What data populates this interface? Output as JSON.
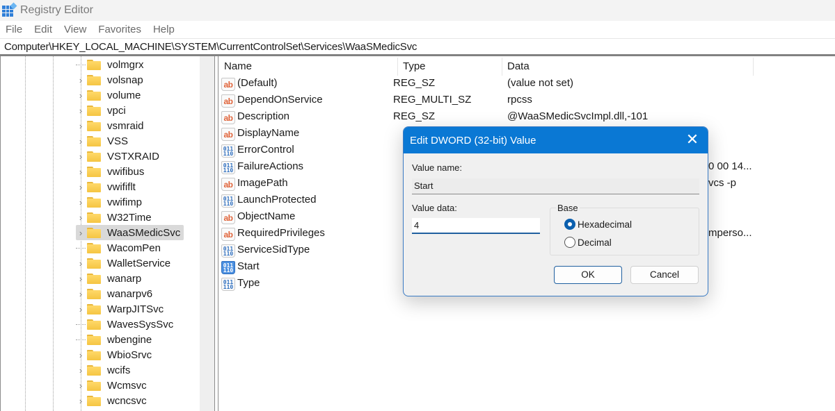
{
  "window": {
    "title": "Registry Editor"
  },
  "menu": [
    "File",
    "Edit",
    "View",
    "Favorites",
    "Help"
  ],
  "address": "Computer\\HKEY_LOCAL_MACHINE\\SYSTEM\\CurrentControlSet\\Services\\WaaSMedicSvc",
  "tree": {
    "items": [
      {
        "label": "volmgrx",
        "expandable": false,
        "selected": false
      },
      {
        "label": "volsnap",
        "expandable": true,
        "selected": false
      },
      {
        "label": "volume",
        "expandable": true,
        "selected": false
      },
      {
        "label": "vpci",
        "expandable": true,
        "selected": false
      },
      {
        "label": "vsmraid",
        "expandable": true,
        "selected": false
      },
      {
        "label": "VSS",
        "expandable": true,
        "selected": false
      },
      {
        "label": "VSTXRAID",
        "expandable": true,
        "selected": false
      },
      {
        "label": "vwifibus",
        "expandable": true,
        "selected": false
      },
      {
        "label": "vwififlt",
        "expandable": true,
        "selected": false
      },
      {
        "label": "vwifimp",
        "expandable": true,
        "selected": false
      },
      {
        "label": "W32Time",
        "expandable": true,
        "selected": false
      },
      {
        "label": "WaaSMedicSvc",
        "expandable": true,
        "selected": true
      },
      {
        "label": "WacomPen",
        "expandable": false,
        "selected": false
      },
      {
        "label": "WalletService",
        "expandable": true,
        "selected": false
      },
      {
        "label": "wanarp",
        "expandable": true,
        "selected": false
      },
      {
        "label": "wanarpv6",
        "expandable": true,
        "selected": false
      },
      {
        "label": "WarpJITSvc",
        "expandable": true,
        "selected": false
      },
      {
        "label": "WavesSysSvc",
        "expandable": false,
        "selected": false
      },
      {
        "label": "wbengine",
        "expandable": false,
        "selected": false
      },
      {
        "label": "WbioSrvc",
        "expandable": true,
        "selected": false
      },
      {
        "label": "wcifs",
        "expandable": true,
        "selected": false
      },
      {
        "label": "Wcmsvc",
        "expandable": true,
        "selected": false
      },
      {
        "label": "wcncsvc",
        "expandable": true,
        "selected": false
      }
    ]
  },
  "values_list": {
    "columns": {
      "name": "Name",
      "type": "Type",
      "data": "Data"
    },
    "rows": [
      {
        "name": "(Default)",
        "type": "REG_SZ",
        "data": "(value not set)",
        "icon": "string"
      },
      {
        "name": "DependOnService",
        "type": "REG_MULTI_SZ",
        "data": "rpcss",
        "icon": "string"
      },
      {
        "name": "Description",
        "type": "REG_SZ",
        "data": "@WaaSMedicSvcImpl.dll,-101",
        "icon": "string"
      },
      {
        "name": "DisplayName",
        "type": "",
        "data": "",
        "icon": "string"
      },
      {
        "name": "ErrorControl",
        "type": "",
        "data": "",
        "icon": "binary"
      },
      {
        "name": "FailureActions",
        "type": "",
        "data": "",
        "icon": "binary",
        "data_visible_tail": "0 00 14..."
      },
      {
        "name": "ImagePath",
        "type": "",
        "data": "",
        "icon": "string",
        "data_visible_tail": "vcs -p"
      },
      {
        "name": "LaunchProtected",
        "type": "",
        "data": "",
        "icon": "binary"
      },
      {
        "name": "ObjectName",
        "type": "",
        "data": "",
        "icon": "string"
      },
      {
        "name": "RequiredPrivileges",
        "type": "",
        "data": "",
        "icon": "string",
        "data_visible_tail": "mperso..."
      },
      {
        "name": "ServiceSidType",
        "type": "",
        "data": "",
        "icon": "binary"
      },
      {
        "name": "Start",
        "type": "",
        "data": "",
        "icon": "binary",
        "selected": true
      },
      {
        "name": "Type",
        "type": "",
        "data": "",
        "icon": "binary"
      }
    ]
  },
  "dialog": {
    "title": "Edit DWORD (32-bit) Value",
    "value_name_label": "Value name:",
    "value_name": "Start",
    "value_data_label": "Value data:",
    "value_data": "4",
    "base_label": "Base",
    "base_options": [
      {
        "label": "Hexadecimal",
        "checked": true
      },
      {
        "label": "Decimal",
        "checked": false
      }
    ],
    "ok_label": "OK",
    "cancel_label": "Cancel",
    "close_glyph": "✕"
  },
  "icons": {
    "string_glyph": "ab",
    "binary_glyph": "011\n110"
  },
  "colors": {
    "title_bar_accent": "#0a78d4",
    "selection_gray": "#d9d9d9",
    "string_icon": "#e0643a",
    "binary_icon": "#2f6fbf"
  }
}
